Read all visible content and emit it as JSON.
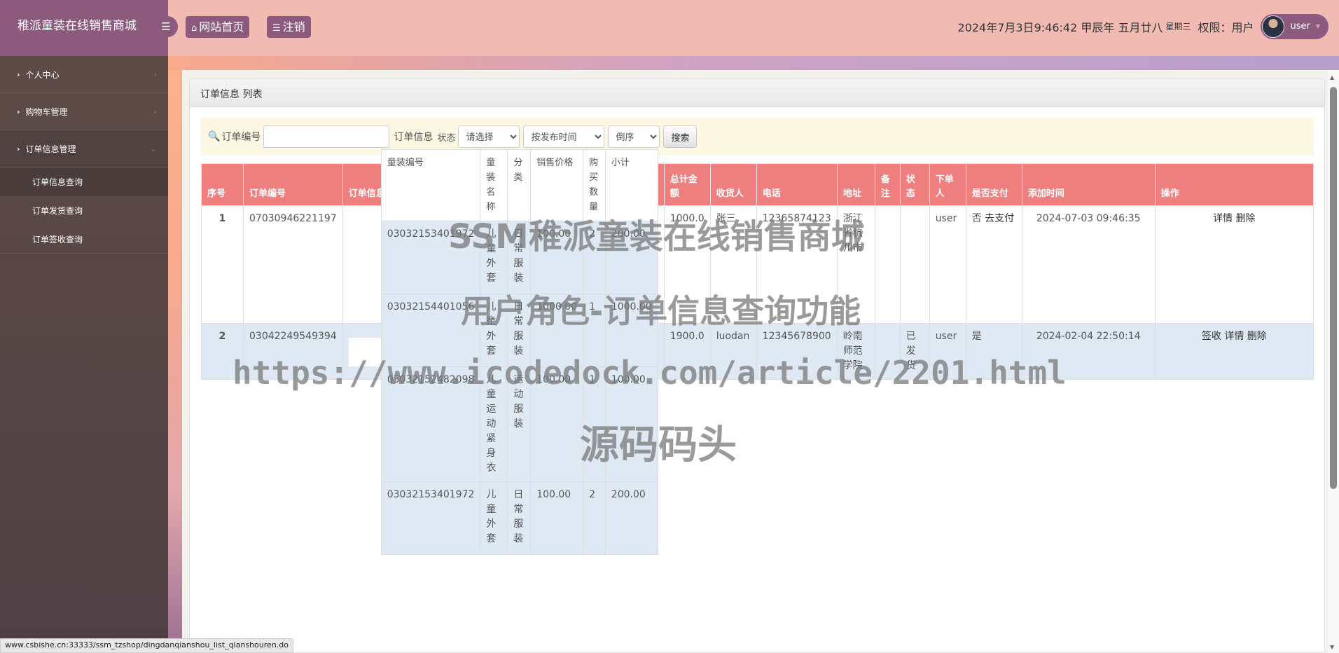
{
  "header": {
    "brand": "稚派童装在线销售商城",
    "menu_toggle_icon": "bars-icon",
    "home_button": "网站首页",
    "logout_button": "注销",
    "datetime": "2024年7月3日9:46:42 甲辰年 五月廿八",
    "weekday": "星期三",
    "role_label": "权限：用户",
    "username": "user"
  },
  "sidebar": {
    "items": [
      {
        "label": "个人中心",
        "expanded": false
      },
      {
        "label": "购物车管理",
        "expanded": false
      },
      {
        "label": "订单信息管理",
        "expanded": true
      }
    ],
    "subitems": [
      {
        "label": "订单信息查询",
        "active": true
      },
      {
        "label": "订单发货查询",
        "active": false
      },
      {
        "label": "订单签收查询",
        "active": false
      }
    ]
  },
  "panel": {
    "title": "订单信息 列表"
  },
  "search": {
    "order_no_label": "订单编号",
    "order_no_value": "",
    "order_info_label": "订单信息",
    "status_label": "状态",
    "status_select": "请选择",
    "sort_select": "按发布时间",
    "order_select": "倒序",
    "search_button": "搜索"
  },
  "table": {
    "headers": [
      "序号",
      "订单编号",
      "订单信息",
      "总计金额",
      "收货人",
      "电话",
      "地址",
      "备注",
      "状态",
      "下单人",
      "是否支付",
      "添加时间",
      "操作"
    ],
    "sub_headers": [
      "童装编号",
      "童装名称",
      "分类",
      "销售价格",
      "购买数量",
      "小计"
    ],
    "rows": [
      {
        "index": "1",
        "order_no": "07030946221197",
        "items": [
          [
            "03032154401056",
            "儿童外套",
            "日常服装",
            "1000.00",
            "1",
            "1000.00"
          ]
        ],
        "total": "1000.0",
        "receiver": "张三",
        "phone": "12365874123",
        "address": "浙江省杭州市",
        "remark": "",
        "status": "",
        "orderer": "user",
        "paid": "否",
        "pay_link": "去支付",
        "created": "2024-07-03 09:46:35",
        "actions": [
          "详情",
          "删除"
        ]
      },
      {
        "index": "2",
        "order_no": "03042249549394",
        "items": [
          [
            "03032153401972",
            "儿童外套",
            "日常服装",
            "100.00",
            "2",
            "200.00"
          ],
          [
            "03032154401056",
            "儿童外套",
            "日常服装",
            "1000.00",
            "1",
            "1000.00"
          ],
          [
            "03032152482098",
            "儿童运动紧身衣",
            "运动服装",
            "100.00",
            "1",
            "100.00"
          ],
          [
            "03032153401972",
            "儿童外套",
            "日常服装",
            "100.00",
            "2",
            "200.00"
          ]
        ],
        "total": "1900.0",
        "receiver": "luodan",
        "phone": "12345678900",
        "address": "岭南师范学院",
        "remark": "",
        "status": "已发货",
        "orderer": "user",
        "paid": "是",
        "pay_link": "",
        "created": "2024-02-04 22:50:14",
        "actions": [
          "签收",
          "详情",
          "删除"
        ]
      }
    ]
  },
  "watermarks": [
    "SSM稚派童装在线销售商城",
    "用户角色-订单信息查询功能",
    "https://www.icodedock.com/article/2201.html",
    "源码码头"
  ],
  "status_url": "www.csbishe.cn:33333/ssm_tzshop/dingdanqianshou_list_qianshouren.do",
  "colors": {
    "brand": "#8b5a7d",
    "table_header": "#ef7f7f",
    "row_alt": "#dfe9f3",
    "search_bg": "#fcf8e3"
  }
}
